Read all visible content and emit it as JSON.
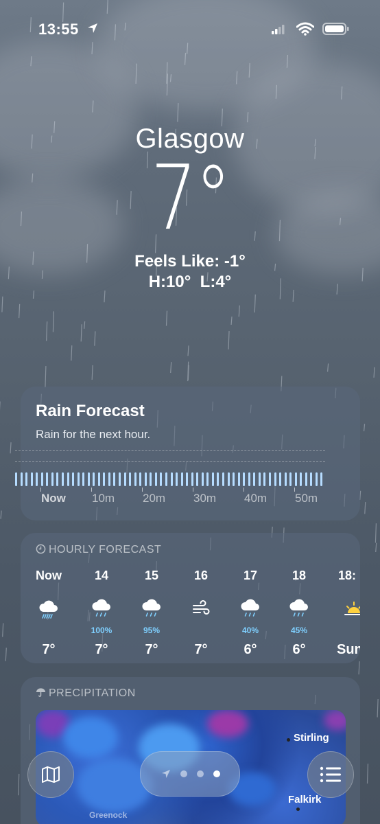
{
  "status_bar": {
    "time": "13:55",
    "icons": [
      "location-arrow-icon",
      "cellular-signal-icon",
      "wifi-icon",
      "battery-icon"
    ]
  },
  "weather": {
    "city": "Glasgow",
    "temperature": "7°",
    "feels_like": "Feels Like: -1°",
    "high_low": "H:10°  L:4°"
  },
  "rain_forecast": {
    "title": "Rain Forecast",
    "subtitle": "Rain for the next hour.",
    "axis": [
      "Now",
      "10m",
      "20m",
      "30m",
      "40m",
      "50m"
    ],
    "intensity_level": "steady light rain for full hour"
  },
  "hourly": {
    "header": "HOURLY FORECAST",
    "items": [
      {
        "time": "Now",
        "icon": "heavy-rain-cloud-icon",
        "prob": "",
        "temp": "7°"
      },
      {
        "time": "14",
        "icon": "rain-cloud-icon",
        "prob": "100%",
        "temp": "7°"
      },
      {
        "time": "15",
        "icon": "rain-cloud-icon",
        "prob": "95%",
        "temp": "7°"
      },
      {
        "time": "16",
        "icon": "wind-icon",
        "prob": "",
        "temp": "7°"
      },
      {
        "time": "17",
        "icon": "rain-cloud-icon",
        "prob": "40%",
        "temp": "6°"
      },
      {
        "time": "18",
        "icon": "rain-cloud-icon",
        "prob": "45%",
        "temp": "6°"
      },
      {
        "time": "18:",
        "icon": "sunset-icon",
        "prob": "",
        "temp": "Sun"
      }
    ]
  },
  "precipitation": {
    "header": "PRECIPITATION",
    "labels": {
      "stirling": "Stirling",
      "falkirk": "Falkirk",
      "greenock": "Greenock"
    }
  },
  "bottom_bar": {
    "map_button_icon": "map-icon",
    "list_button_icon": "list-icon",
    "page_dots": 3,
    "active_page": 3
  },
  "colors": {
    "rain_bar": "#b6dcff",
    "probability_text": "#7fd0ff",
    "card_background": "rgba(90,104,124,0.55)"
  }
}
